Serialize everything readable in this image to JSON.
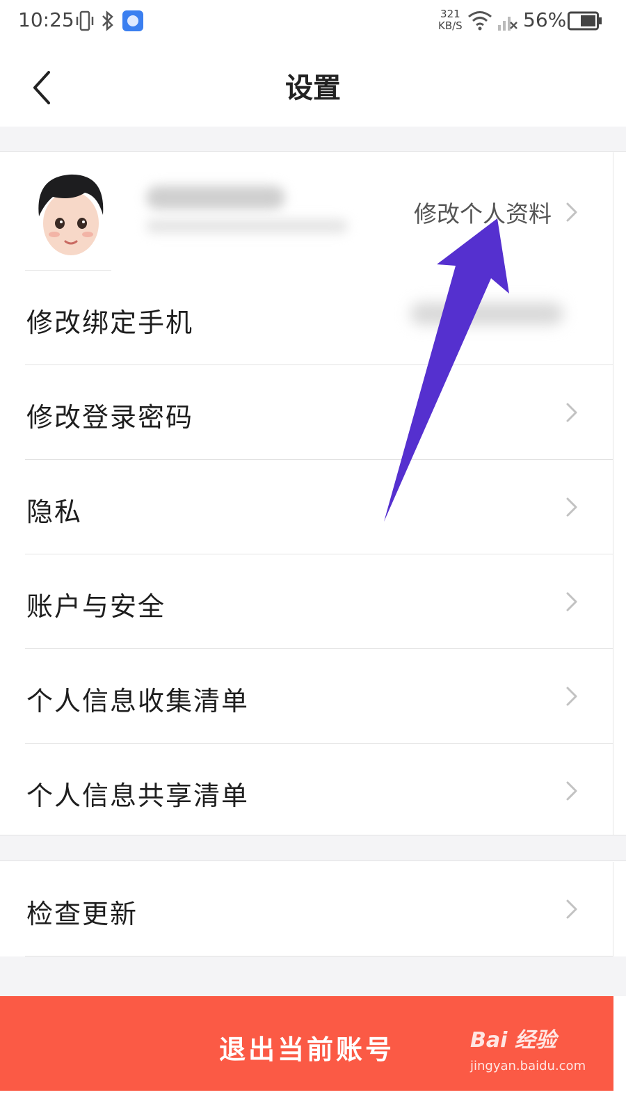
{
  "status_bar": {
    "time": "10:25",
    "net_speed_value": "321",
    "net_speed_unit": "KB/S",
    "battery_percent": "56%"
  },
  "header": {
    "title": "设置",
    "back_icon": "chevron-left-icon"
  },
  "profile": {
    "edit_label": "修改个人资料"
  },
  "settings": {
    "items": [
      {
        "label": "修改绑定手机"
      },
      {
        "label": "修改登录密码"
      },
      {
        "label": "隐私"
      },
      {
        "label": "账户与安全"
      },
      {
        "label": "个人信息收集清单"
      },
      {
        "label": "个人信息共享清单"
      }
    ]
  },
  "settings2": {
    "items": [
      {
        "label": "检查更新"
      }
    ]
  },
  "logout": {
    "label": "退出当前账号"
  },
  "watermark": {
    "logo": "Bai 经验",
    "url": "jingyan.baidu.com"
  },
  "colors": {
    "logout_bg": "#fb5a45",
    "annotation_arrow": "#5530cf",
    "page_gap_bg": "#f4f4f6"
  }
}
